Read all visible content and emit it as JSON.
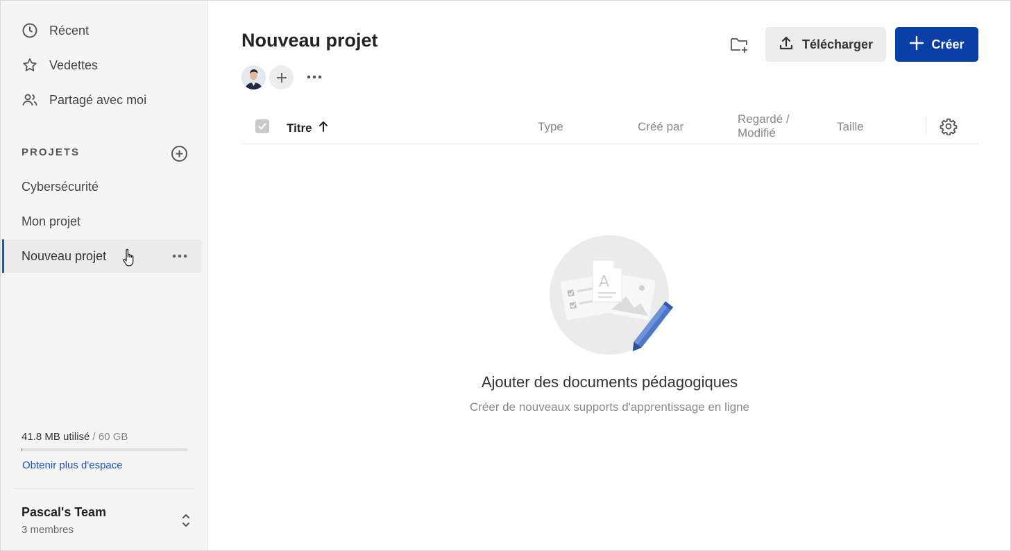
{
  "sidebar": {
    "nav": [
      {
        "label": "Récent",
        "icon": "clock-icon"
      },
      {
        "label": "Vedettes",
        "icon": "star-icon"
      },
      {
        "label": "Partagé avec moi",
        "icon": "users-icon"
      }
    ],
    "projects_title": "PROJETS",
    "projects": [
      {
        "label": "Cybersécurité"
      },
      {
        "label": "Mon projet"
      },
      {
        "label": "Nouveau projet",
        "active": true
      }
    ],
    "storage": {
      "used": "41.8 MB utilisé",
      "total": " / 60 GB",
      "used_fraction": 0.0007,
      "more_space_link": "Obtenir plus d'espace"
    },
    "team": {
      "name": "Pascal's Team",
      "members": "3 membres"
    }
  },
  "main": {
    "title": "Nouveau projet",
    "upload_label": "Télécharger",
    "create_label": "Créer",
    "table": {
      "col_title": "Titre",
      "col_type": "Type",
      "col_created_by": "Créé par",
      "col_viewed_line1": "Regardé /",
      "col_viewed_line2": "Modifié",
      "col_size": "Taille"
    },
    "empty": {
      "title": "Ajouter des documents pédagogiques",
      "subtitle": "Créer de nouveaux supports d'apprentissage en ligne"
    }
  },
  "colors": {
    "accent": "#0b3fa8",
    "sidebar_bg": "#f5f5f5"
  }
}
